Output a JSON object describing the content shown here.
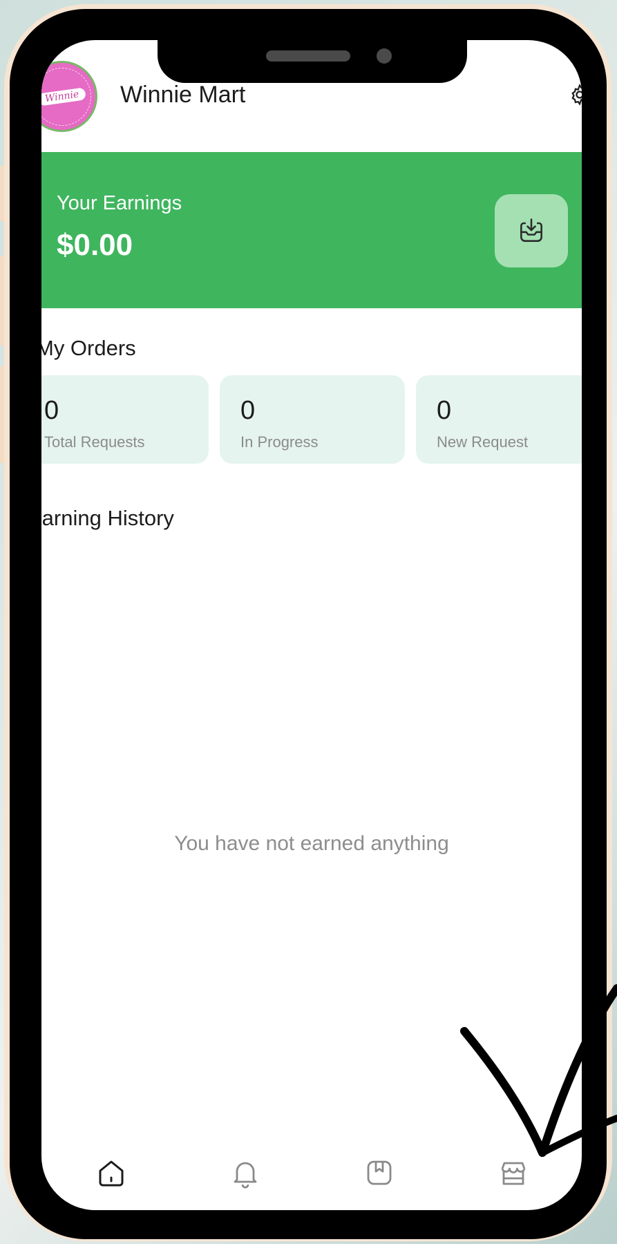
{
  "header": {
    "store_name": "Winnie Mart",
    "avatar_text": "Winnie"
  },
  "earnings": {
    "label": "Your Earnings",
    "amount": "$0.00"
  },
  "orders": {
    "title": "My Orders",
    "stats": [
      {
        "value": "0",
        "label": "Total Requests"
      },
      {
        "value": "0",
        "label": "In Progress"
      },
      {
        "value": "0",
        "label": "New Request"
      }
    ]
  },
  "history": {
    "title": "Earning History",
    "empty_message": "You have not earned anything"
  },
  "bottom_nav": [
    {
      "icon": "home-icon",
      "active": true
    },
    {
      "icon": "bell-icon",
      "active": false
    },
    {
      "icon": "bookmark-icon",
      "active": false
    },
    {
      "icon": "store-icon",
      "active": false
    }
  ],
  "colors": {
    "accent_green": "#3fb55e",
    "card_bg": "#e5f4ee",
    "withdraw_bg": "#a5e0b3"
  }
}
